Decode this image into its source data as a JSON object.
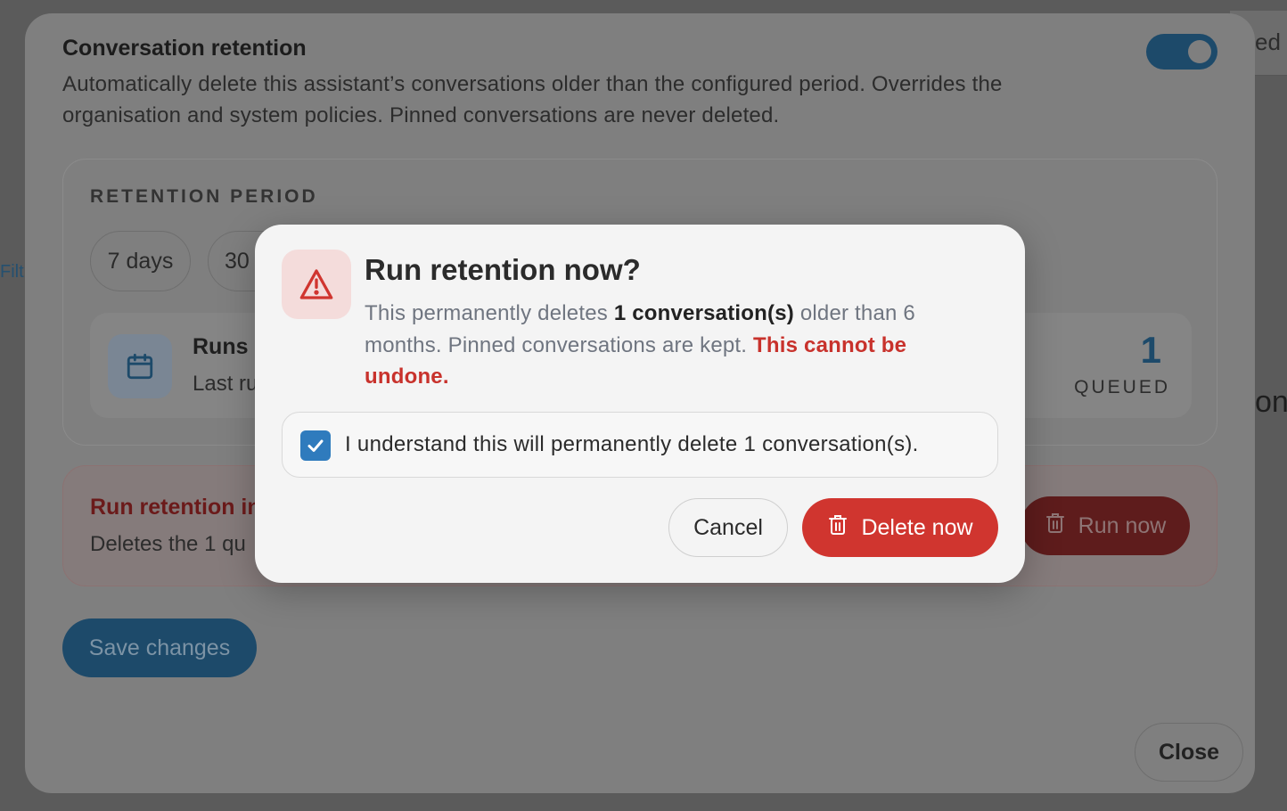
{
  "background": {
    "top_right_fragment": "ed",
    "left_fragment": "Filt",
    "right_fragment": "on"
  },
  "settings": {
    "title": "Conversation retention",
    "description": "Automatically delete this assistant’s conversations older than the configured period. Overrides the organisation and system policies. Pinned conversations are never deleted.",
    "toggle_enabled": true,
    "period_label": "RETENTION PERIOD",
    "period_options": [
      "7 days",
      "30"
    ],
    "runs_title": "Runs a",
    "runs_sub": "Last ru",
    "queued_count": "1",
    "queued_label": "QUEUED",
    "danger_title": "Run retention in",
    "danger_sub": "Deletes the 1 qu",
    "run_now_label": "Run now",
    "save_label": "Save changes",
    "close_label": "Close"
  },
  "confirm": {
    "title": "Run retention now?",
    "body_prefix": "This permanently deletes ",
    "body_count": "1 conversation(s)",
    "body_middle": " older than 6 months. Pinned conversations are kept. ",
    "body_warning": "This cannot be undone.",
    "ack_checked": true,
    "ack_label": "I understand this will permanently delete 1 conversation(s).",
    "cancel_label": "Cancel",
    "delete_label": "Delete now"
  },
  "colors": {
    "accent_blue": "#2f7bbd",
    "danger_red": "#d0352f",
    "warning_bg": "#f4dcdb"
  }
}
